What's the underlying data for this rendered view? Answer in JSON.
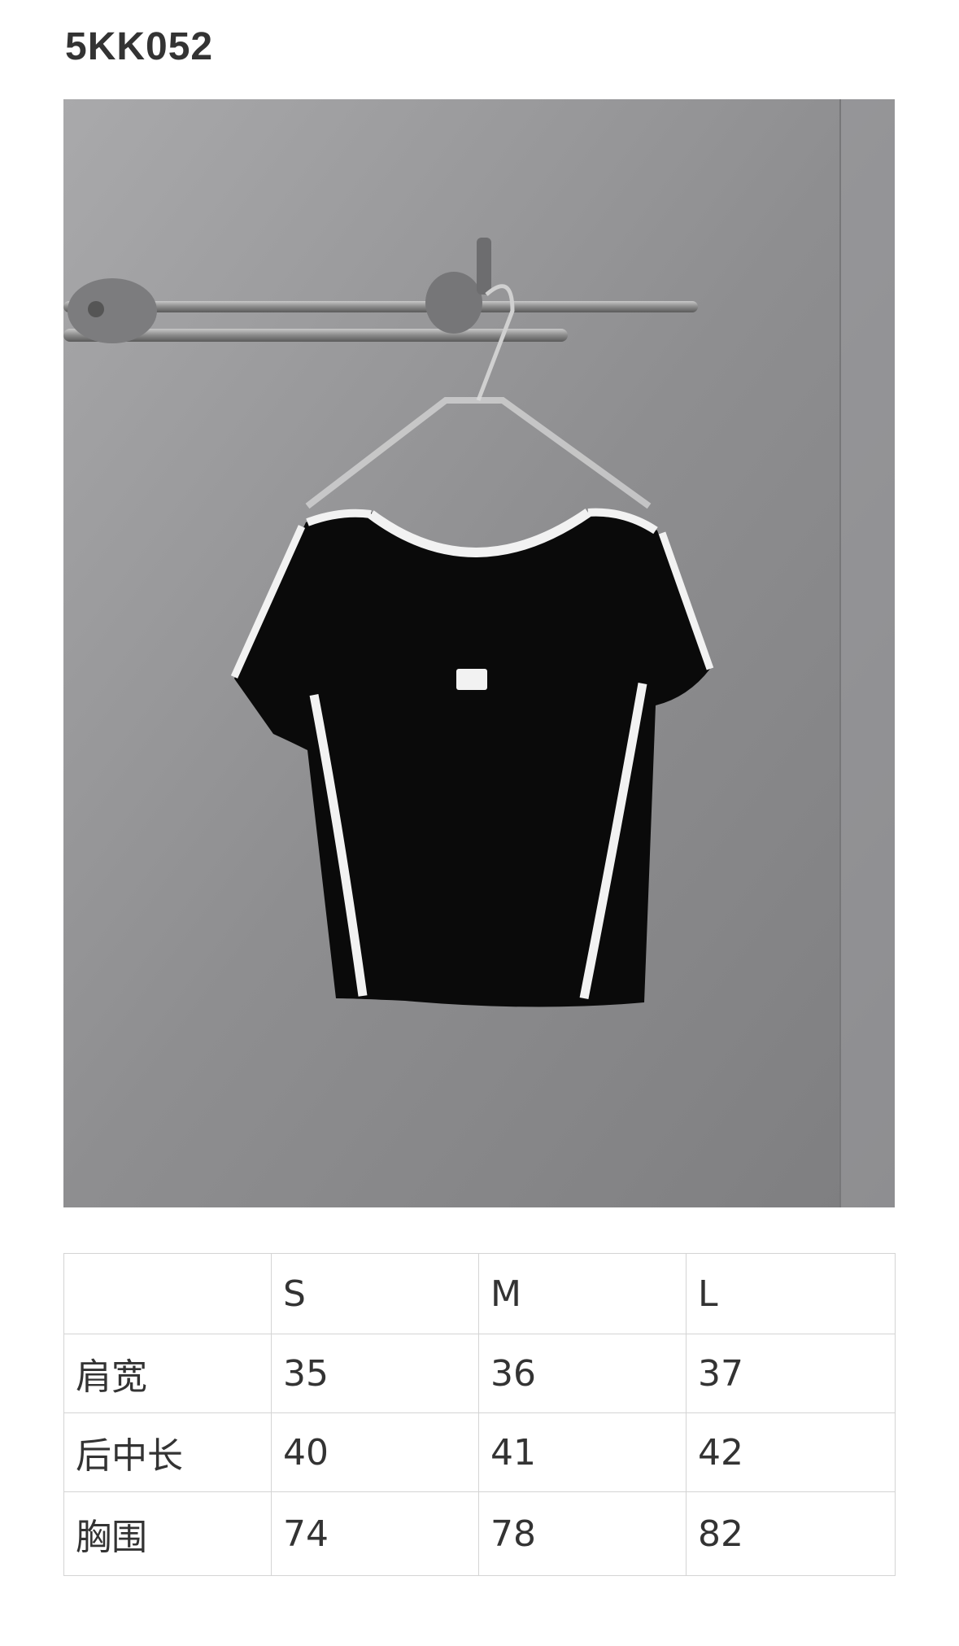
{
  "product": {
    "code": "5KK052"
  },
  "photo": {
    "icon": "black-tshirt-photo",
    "background_color": "#8f8f91",
    "garment_color": "#0a0a0a",
    "trim_color": "#f2f2f2"
  },
  "size_table": {
    "header": [
      "",
      "S",
      "M",
      "L"
    ],
    "rows": [
      {
        "label": "肩宽",
        "values": [
          "35",
          "36",
          "37"
        ]
      },
      {
        "label": "后中长",
        "values": [
          "40",
          "41",
          "42"
        ]
      },
      {
        "label": "胸围",
        "values": [
          "74",
          "78",
          "82"
        ]
      }
    ]
  }
}
